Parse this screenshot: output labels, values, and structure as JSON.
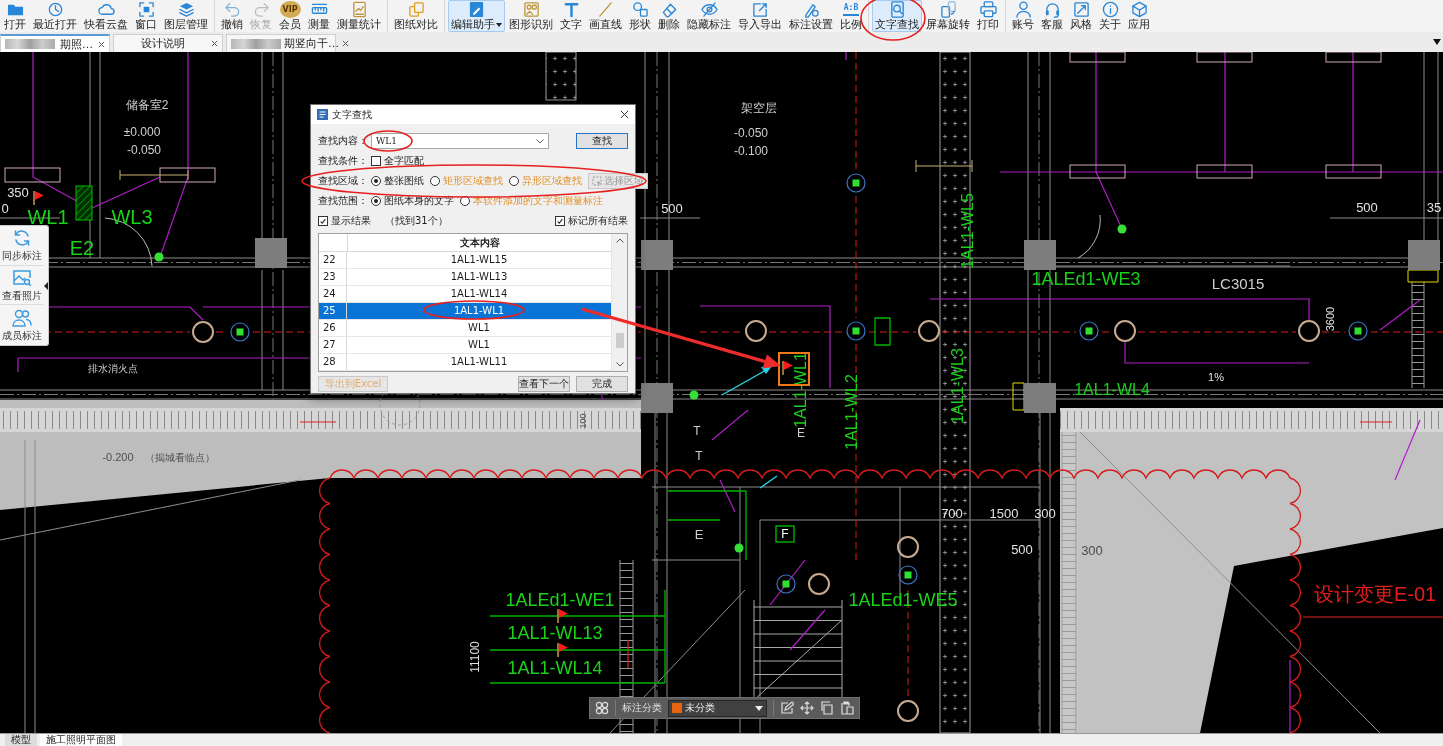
{
  "toolbar": {
    "groups": [
      {
        "items": [
          {
            "label": "打开",
            "active": false,
            "disabled": false,
            "dropdown": false
          },
          {
            "label": "最近打开",
            "active": false,
            "disabled": false,
            "dropdown": false
          },
          {
            "label": "快看云盘",
            "active": false,
            "disabled": false,
            "dropdown": false
          },
          {
            "label": "窗口",
            "active": false,
            "disabled": false,
            "dropdown": false
          },
          {
            "label": "图层管理",
            "active": false,
            "disabled": false,
            "dropdown": false
          }
        ]
      },
      {
        "items": [
          {
            "label": "撤销",
            "active": false,
            "disabled": false,
            "dropdown": false
          },
          {
            "label": "恢复",
            "active": false,
            "disabled": true,
            "dropdown": false
          },
          {
            "label": "会员",
            "active": false,
            "disabled": false,
            "dropdown": false,
            "badge": {
              "text": "VIP",
              "kind": "vip"
            }
          },
          {
            "label": "测量",
            "active": false,
            "disabled": false,
            "dropdown": false
          },
          {
            "label": "测量统计",
            "active": false,
            "disabled": false,
            "dropdown": false
          }
        ]
      },
      {
        "items": [
          {
            "label": "图纸对比",
            "active": false,
            "disabled": false,
            "dropdown": false
          }
        ]
      },
      {
        "items": [
          {
            "label": "编辑助手",
            "active": true,
            "disabled": false,
            "dropdown": true
          },
          {
            "label": "图形识别",
            "active": false,
            "disabled": false,
            "dropdown": false
          },
          {
            "label": "文字",
            "active": false,
            "disabled": false,
            "dropdown": false
          },
          {
            "label": "画直线",
            "active": false,
            "disabled": false,
            "dropdown": false
          },
          {
            "label": "形状",
            "active": false,
            "disabled": false,
            "dropdown": false
          },
          {
            "label": "删除",
            "active": false,
            "disabled": false,
            "dropdown": false
          },
          {
            "label": "隐藏标注",
            "active": false,
            "disabled": false,
            "dropdown": false
          },
          {
            "label": "导入导出",
            "active": false,
            "disabled": false,
            "dropdown": false
          },
          {
            "label": "标注设置",
            "active": false,
            "disabled": false,
            "dropdown": false
          },
          {
            "label": "比例",
            "active": false,
            "disabled": false,
            "dropdown": false,
            "badge": {
              "text": "A:B",
              "kind": "scale"
            }
          }
        ]
      },
      {
        "items": [
          {
            "label": "文字查找",
            "active": true,
            "disabled": false,
            "dropdown": false
          },
          {
            "label": "屏幕旋转",
            "active": false,
            "disabled": false,
            "dropdown": false
          },
          {
            "label": "打印",
            "active": false,
            "disabled": false,
            "dropdown": false
          }
        ]
      },
      {
        "items": [
          {
            "label": "账号",
            "active": false,
            "disabled": false,
            "dropdown": false
          },
          {
            "label": "客服",
            "active": false,
            "disabled": false,
            "dropdown": false
          },
          {
            "label": "风格",
            "active": false,
            "disabled": false,
            "dropdown": false
          },
          {
            "label": "关于",
            "active": false,
            "disabled": false,
            "dropdown": false
          },
          {
            "label": "应用",
            "active": false,
            "disabled": false,
            "dropdown": false
          }
        ]
      }
    ]
  },
  "document_tabs": [
    {
      "label": "期照…",
      "selected": true,
      "blurred": true
    },
    {
      "label": "设计说明",
      "selected": false,
      "blurred": false
    },
    {
      "label": "期竖向干…",
      "selected": false,
      "blurred": true
    }
  ],
  "side_panel": {
    "items": [
      {
        "label": "同步标注"
      },
      {
        "label": "查看照片"
      },
      {
        "label": "成员标注"
      }
    ]
  },
  "drawing": {
    "labels": [
      {
        "text": "储备室2",
        "kind": "room",
        "flagged": false,
        "highlighted": false
      },
      {
        "text": "±0.000",
        "kind": "level",
        "flagged": false,
        "highlighted": false
      },
      {
        "text": "-0.050",
        "kind": "level",
        "flagged": false,
        "highlighted": false
      },
      {
        "text": "350",
        "kind": "dim",
        "flagged": false,
        "highlighted": false
      },
      {
        "text": "0",
        "kind": "dim",
        "flagged": false,
        "highlighted": false
      },
      {
        "text": "WL1",
        "kind": "circuit",
        "flagged": true,
        "highlighted": false
      },
      {
        "text": "WL3",
        "kind": "circuit",
        "flagged": false,
        "highlighted": false
      },
      {
        "text": "E2",
        "kind": "circuit",
        "flagged": false,
        "highlighted": false
      },
      {
        "text": "排水消火点",
        "kind": "room",
        "flagged": false,
        "highlighted": false
      },
      {
        "text": "-0.200",
        "kind": "note",
        "flagged": false,
        "highlighted": false
      },
      {
        "text": "（揭城看临点）",
        "kind": "note",
        "flagged": false,
        "highlighted": false
      },
      {
        "text": "架空层",
        "kind": "room",
        "flagged": false,
        "highlighted": false
      },
      {
        "text": "-0.050",
        "kind": "level",
        "flagged": false,
        "highlighted": false
      },
      {
        "text": "-0.100",
        "kind": "level",
        "flagged": false,
        "highlighted": false
      },
      {
        "text": "500",
        "kind": "dim",
        "flagged": false,
        "highlighted": false
      },
      {
        "text": "1AL1-WL5",
        "kind": "circuit",
        "flagged": false,
        "highlighted": false
      },
      {
        "text": "500",
        "kind": "dim",
        "flagged": false,
        "highlighted": false
      },
      {
        "text": "35",
        "kind": "dim",
        "flagged": false,
        "highlighted": false
      },
      {
        "text": "1ALEd1-WE3",
        "kind": "circuit",
        "flagged": false,
        "highlighted": false
      },
      {
        "text": "LC3015",
        "kind": "room",
        "flagged": false,
        "highlighted": false
      },
      {
        "text": "3600",
        "kind": "dim",
        "flagged": false,
        "highlighted": false
      },
      {
        "text": "1AL1-WL4",
        "kind": "circuit",
        "flagged": false,
        "highlighted": false
      },
      {
        "text": "1%",
        "kind": "dim",
        "flagged": false,
        "highlighted": false
      },
      {
        "text": "1AL1-WL1",
        "kind": "circuit",
        "flagged": true,
        "highlighted": true
      },
      {
        "text": "1AL1-WL2",
        "kind": "circuit",
        "flagged": false,
        "highlighted": false
      },
      {
        "text": "1AL1-WL3",
        "kind": "circuit",
        "flagged": false,
        "highlighted": false
      },
      {
        "text": "100",
        "kind": "note",
        "flagged": false,
        "highlighted": false
      },
      {
        "text": "T",
        "kind": "room",
        "flagged": false,
        "highlighted": false
      },
      {
        "text": "T",
        "kind": "room",
        "flagged": false,
        "highlighted": false
      },
      {
        "text": "E",
        "kind": "room",
        "flagged": false,
        "highlighted": false
      },
      {
        "text": "700",
        "kind": "dim",
        "flagged": false,
        "highlighted": false
      },
      {
        "text": "1500",
        "kind": "dim",
        "flagged": false,
        "highlighted": false
      },
      {
        "text": "300",
        "kind": "dim",
        "flagged": false,
        "highlighted": false
      },
      {
        "text": "500",
        "kind": "dim",
        "flagged": false,
        "highlighted": false
      },
      {
        "text": "300",
        "kind": "note",
        "flagged": false,
        "highlighted": false
      },
      {
        "text": "E",
        "kind": "room",
        "flagged": false,
        "highlighted": false
      },
      {
        "text": "F",
        "kind": "tag",
        "flagged": false,
        "highlighted": false
      },
      {
        "text": "1ALEd1-WE1",
        "kind": "circuit",
        "flagged": false,
        "highlighted": false
      },
      {
        "text": "1AL1-WL13",
        "kind": "circuit",
        "flagged": true,
        "highlighted": false
      },
      {
        "text": "1AL1-WL14",
        "kind": "circuit",
        "flagged": true,
        "highlighted": false
      },
      {
        "text": "11100",
        "kind": "dim",
        "flagged": false,
        "highlighted": false
      },
      {
        "text": "1ALEd1-WE5",
        "kind": "circuit",
        "flagged": false,
        "highlighted": false
      },
      {
        "text": "设计变更E-01",
        "kind": "revision",
        "flagged": false,
        "highlighted": false
      }
    ]
  },
  "find_dialog": {
    "title": "文字查找",
    "query": {
      "label": "查找内容：",
      "value": "WL1"
    },
    "find_button": "查找",
    "condition": {
      "label": "查找条件：",
      "options": [
        {
          "label": "全字匹配",
          "checked": false
        }
      ]
    },
    "area": {
      "label": "查找区域：",
      "options": [
        {
          "label": "整张图纸",
          "selected": true,
          "premium": false
        },
        {
          "label": "矩形区域查找",
          "selected": false,
          "premium": true
        },
        {
          "label": "异形区域查找",
          "selected": false,
          "premium": true
        }
      ],
      "select_button": {
        "label": "选择区域",
        "disabled": true
      }
    },
    "scope": {
      "label": "查找范围：",
      "options": [
        {
          "label": "图纸本身的文字",
          "selected": true,
          "premium": false
        },
        {
          "label": "本软件添加的文字和测量标注",
          "selected": false,
          "premium": true
        }
      ]
    },
    "show_results": {
      "label": "显示结果",
      "checked": true
    },
    "result_count": "（找到31个）",
    "mark_all": {
      "label": "标记所有结果",
      "checked": true
    },
    "results": {
      "columns": [
        "文本内容"
      ],
      "rows": [
        {
          "index": "22",
          "text": "1AL1-WL15",
          "selected": false
        },
        {
          "index": "23",
          "text": "1AL1-WL13",
          "selected": false
        },
        {
          "index": "24",
          "text": "1AL1-WL14",
          "selected": false
        },
        {
          "index": "25",
          "text": "1AL1-WL1",
          "selected": true
        },
        {
          "index": "26",
          "text": "WL1",
          "selected": false
        },
        {
          "index": "27",
          "text": "WL1",
          "selected": false
        },
        {
          "index": "28",
          "text": "1AL1-WL11",
          "selected": false
        }
      ]
    },
    "buttons": [
      {
        "label": "导出到Excel",
        "disabled": true,
        "premium": true
      },
      {
        "label": "查看下一个",
        "disabled": false,
        "premium": false
      },
      {
        "label": "完成",
        "disabled": false,
        "premium": false
      }
    ]
  },
  "annotation_bar": {
    "label": "标注分类",
    "category": {
      "value": "未分类",
      "color": "#e8630f"
    }
  },
  "layout_tabs": [
    {
      "label": "模型",
      "selected": false
    },
    {
      "label": "施工照明平面图",
      "selected": true
    }
  ]
}
